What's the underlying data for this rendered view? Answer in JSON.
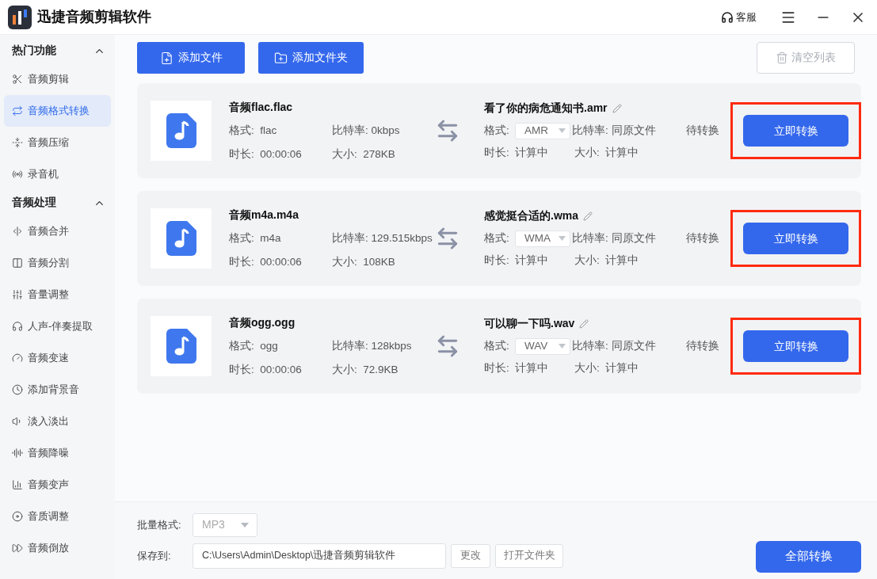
{
  "window": {
    "title": "迅捷音频剪辑软件",
    "support": "客服"
  },
  "sidebar": [
    {
      "title": "热门功能",
      "expanded": true,
      "items": [
        {
          "label": "音频剪辑",
          "selected": false
        },
        {
          "label": "音频格式转换",
          "selected": true
        },
        {
          "label": "音频压缩",
          "selected": false
        },
        {
          "label": "录音机",
          "selected": false
        }
      ]
    },
    {
      "title": "音频处理",
      "expanded": true,
      "items": [
        {
          "label": "音频合并",
          "selected": false
        },
        {
          "label": "音频分割",
          "selected": false
        },
        {
          "label": "音量调整",
          "selected": false
        },
        {
          "label": "人声-伴奏提取",
          "selected": false
        },
        {
          "label": "音频变速",
          "selected": false
        },
        {
          "label": "添加背景音",
          "selected": false
        },
        {
          "label": "淡入淡出",
          "selected": false
        },
        {
          "label": "音频降噪",
          "selected": false
        },
        {
          "label": "音频变声",
          "selected": false
        },
        {
          "label": "音质调整",
          "selected": false
        },
        {
          "label": "音频倒放",
          "selected": false
        }
      ]
    }
  ],
  "toolbar": {
    "add_file": "添加文件",
    "add_folder": "添加文件夹",
    "clear": "清空列表",
    "clear_disabled": true
  },
  "files": [
    {
      "source": {
        "name": "音频flac.flac",
        "format_label": "格式:",
        "format": "flac",
        "bitrate_label": "比特率:",
        "bitrate": "0kbps",
        "duration_label": "时长:",
        "duration": "00:00:06",
        "size_label": "大小:",
        "size": "278KB"
      },
      "target": {
        "name": "看了你的病危通知书.amr",
        "format_label": "格式:",
        "format": "AMR",
        "bitrate_label": "比特率:",
        "bitrate": "同原文件",
        "duration_label": "时长:",
        "duration": "计算中",
        "size_label": "大小:",
        "size": "计算中"
      },
      "status": "待转换",
      "button": "立即转换",
      "highlighted": true
    },
    {
      "source": {
        "name": "音频m4a.m4a",
        "format_label": "格式:",
        "format": "m4a",
        "bitrate_label": "比特率:",
        "bitrate": "129.515kbps",
        "duration_label": "时长:",
        "duration": "00:00:06",
        "size_label": "大小:",
        "size": "108KB"
      },
      "target": {
        "name": "感觉挺合适的.wma",
        "format_label": "格式:",
        "format": "WMA",
        "bitrate_label": "比特率:",
        "bitrate": "同原文件",
        "duration_label": "时长:",
        "duration": "计算中",
        "size_label": "大小:",
        "size": "计算中"
      },
      "status": "待转换",
      "button": "立即转换",
      "highlighted": true
    },
    {
      "source": {
        "name": "音频ogg.ogg",
        "format_label": "格式:",
        "format": "ogg",
        "bitrate_label": "比特率:",
        "bitrate": "128kbps",
        "duration_label": "时长:",
        "duration": "00:00:06",
        "size_label": "大小:",
        "size": "72.9KB"
      },
      "target": {
        "name": "可以聊一下吗.wav",
        "format_label": "格式:",
        "format": "WAV",
        "bitrate_label": "比特率:",
        "bitrate": "同原文件",
        "duration_label": "时长:",
        "duration": "计算中",
        "size_label": "大小:",
        "size": "计算中"
      },
      "status": "待转换",
      "button": "立即转换",
      "highlighted": true
    }
  ],
  "footer": {
    "batch_label": "批量格式:",
    "batch_format": "MP3",
    "save_label": "保存到:",
    "save_path": "C:\\Users\\Admin\\Desktop\\迅捷音频剪辑软件",
    "change": "更改",
    "open_folder": "打开文件夹",
    "convert_all": "全部转换"
  }
}
